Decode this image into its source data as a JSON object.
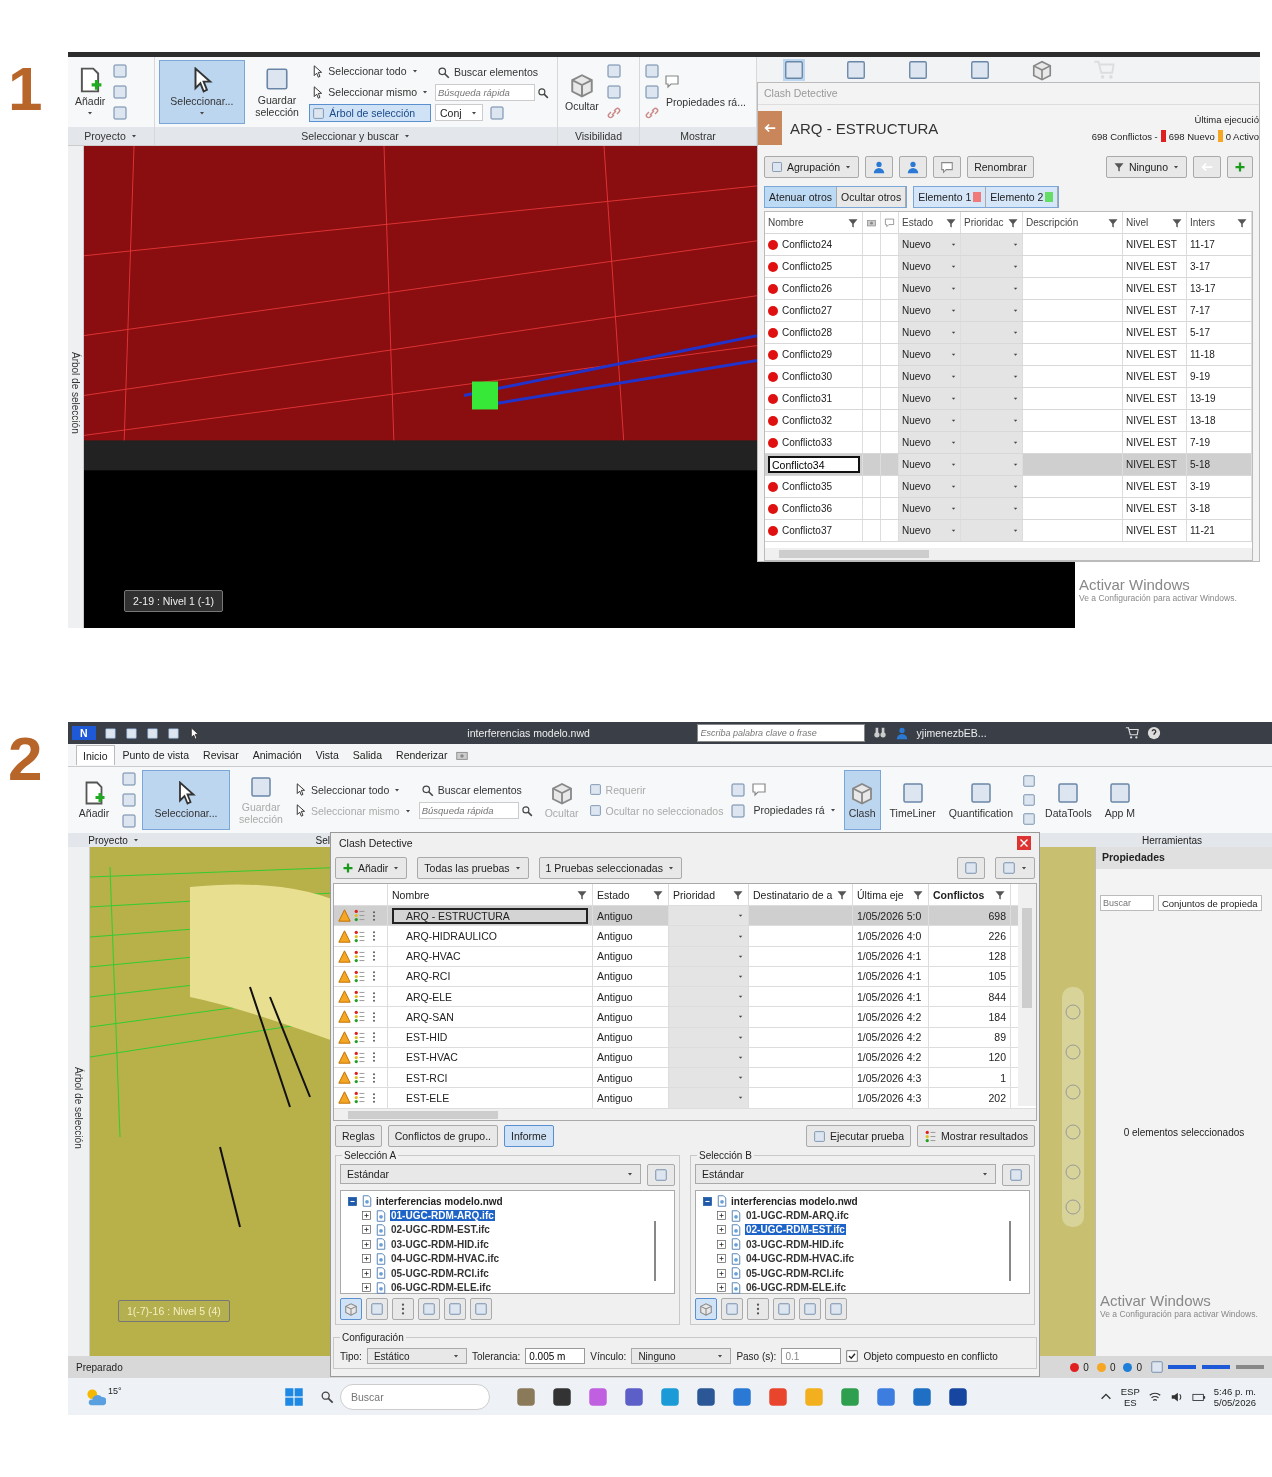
{
  "fig1": {
    "number": "1",
    "ribbon": {
      "add": "Añadir",
      "select": {
        "label": "Seleccionar...",
        "selected": true
      },
      "save": "Guardar selección",
      "select_all": "Seleccionar todo",
      "select_same": "Seleccionar mismo",
      "tree": {
        "label": "Árbol de selección",
        "selected": true
      },
      "find": "Buscar elementos",
      "quick_find": {
        "placeholder": "Búsqueda rápida"
      },
      "sets": "Conj",
      "hide": "Ocultar",
      "properties": "Propiedades rá...",
      "panels": [
        {
          "label": "Proyecto",
          "menu": true
        },
        {
          "label": "Seleccionar y buscar",
          "menu": true
        },
        {
          "label": "Visibilidad",
          "menu": false
        },
        {
          "label": "Mostrar",
          "menu": false
        }
      ]
    },
    "side_tab": "Árbol de selección",
    "viewport": {
      "label": "2-19 : Nivel 1 (-1)"
    },
    "clash": {
      "title": "Clash Detective",
      "test": "ARQ - ESTRUCTURA",
      "last_run": "Última ejecució",
      "total": "698 Conflictos -",
      "counts": [
        {
          "label": "698 Nuevo",
          "color": "#e02020"
        },
        {
          "label": "0 Activo",
          "color": "#f5a623"
        }
      ],
      "grouping": "Agrupación",
      "rename": "Renombrar",
      "assign": "Ninguno",
      "modes": [
        {
          "label": "Atenuar otros",
          "selected": true
        },
        {
          "label": "Ocultar otros",
          "selected": false
        }
      ],
      "items": [
        {
          "label": "Elemento 1",
          "color": "#f07a7a"
        },
        {
          "label": "Elemento 2",
          "color": "#66dd66"
        }
      ],
      "columns": [
        {
          "kind": "text",
          "label": "Nombre"
        },
        {
          "kind": "camera"
        },
        {
          "kind": "comment"
        },
        {
          "kind": "text",
          "label": "Estado"
        },
        {
          "kind": "text",
          "label": "Prioridac"
        },
        {
          "kind": "text",
          "label": "Descripción"
        },
        {
          "kind": "text",
          "label": "Nivel"
        },
        {
          "kind": "text",
          "label": "Inters"
        }
      ],
      "rows": [
        {
          "name": "Conflicto24",
          "status": "Nuevo",
          "tier": "NIVEL EST",
          "grid": "11-17",
          "selected": false
        },
        {
          "name": "Conflicto25",
          "status": "Nuevo",
          "tier": "NIVEL EST",
          "grid": "3-17",
          "selected": false
        },
        {
          "name": "Conflicto26",
          "status": "Nuevo",
          "tier": "NIVEL EST",
          "grid": "13-17",
          "selected": false
        },
        {
          "name": "Conflicto27",
          "status": "Nuevo",
          "tier": "NIVEL EST",
          "grid": "7-17",
          "selected": false
        },
        {
          "name": "Conflicto28",
          "status": "Nuevo",
          "tier": "NIVEL EST",
          "grid": "5-17",
          "selected": false
        },
        {
          "name": "Conflicto29",
          "status": "Nuevo",
          "tier": "NIVEL EST",
          "grid": "11-18",
          "selected": false
        },
        {
          "name": "Conflicto30",
          "status": "Nuevo",
          "tier": "NIVEL EST",
          "grid": "9-19",
          "selected": false
        },
        {
          "name": "Conflicto31",
          "status": "Nuevo",
          "tier": "NIVEL EST",
          "grid": "13-19",
          "selected": false
        },
        {
          "name": "Conflicto32",
          "status": "Nuevo",
          "tier": "NIVEL EST",
          "grid": "13-18",
          "selected": false
        },
        {
          "name": "Conflicto33",
          "status": "Nuevo",
          "tier": "NIVEL EST",
          "grid": "7-19",
          "selected": false
        },
        {
          "name": "Conflicto34",
          "status": "Nuevo",
          "tier": "NIVEL EST",
          "grid": "5-18",
          "selected": true
        },
        {
          "name": "Conflicto35",
          "status": "Nuevo",
          "tier": "NIVEL EST",
          "grid": "3-19",
          "selected": false
        },
        {
          "name": "Conflicto36",
          "status": "Nuevo",
          "tier": "NIVEL EST",
          "grid": "3-18",
          "selected": false
        },
        {
          "name": "Conflicto37",
          "status": "Nuevo",
          "tier": "NIVEL EST",
          "grid": "11-21",
          "selected": false
        }
      ]
    },
    "watermark": {
      "title": "Activar Windows",
      "text": "Ve a Configuración para activar Windows."
    }
  },
  "fig2": {
    "number": "2",
    "titlebar": {
      "logo": "N",
      "title": "interferencias modelo.nwd",
      "search": {
        "placeholder": "Escriba palabra clave o frase"
      },
      "user": "yjimenezbEB..."
    },
    "menu": [
      {
        "label": "Inicio",
        "selected": true
      },
      {
        "label": "Punto de vista",
        "selected": false
      },
      {
        "label": "Revisar",
        "selected": false
      },
      {
        "label": "Animación",
        "selected": false
      },
      {
        "label": "Vista",
        "selected": false
      },
      {
        "label": "Salida",
        "selected": false
      },
      {
        "label": "Renderizar",
        "selected": false
      }
    ],
    "ribbon": {
      "add": "Añadir",
      "select": {
        "label": "Seleccionar...",
        "selected": true
      },
      "save": {
        "label": "Guardar selección",
        "disabled": true
      },
      "select_all": {
        "label": "Seleccionar todo",
        "disabled": false
      },
      "select_same": {
        "label": "Seleccionar mismo",
        "disabled": true
      },
      "find": "Buscar elementos",
      "quick_find": {
        "placeholder": "Búsqueda rápida"
      },
      "hide": {
        "label": "Ocultar",
        "disabled": true
      },
      "require": {
        "label": "Requerir",
        "disabled": true
      },
      "hide_unselected": {
        "label": "Ocultar no seleccionados",
        "disabled": true
      },
      "properties": "Propiedades rá",
      "tools": [
        {
          "label": "Clash",
          "selected": true
        },
        {
          "label": "TimeLiner",
          "selected": false
        },
        {
          "label": "Quantification",
          "selected": false
        },
        {
          "label": "DataTools",
          "selected": false
        },
        {
          "label": "App M",
          "selected": false
        }
      ],
      "panels": [
        {
          "label": "Proyecto",
          "menu": true
        },
        {
          "label": "Sel",
          "menu": false
        },
        {
          "label": "Herramientas",
          "menu": false
        }
      ]
    },
    "side_tab": "Árbol de selección",
    "viewport": {
      "label": "1(-7)-16 : Nivel 5 (4)"
    },
    "properties": {
      "title": "Propiedades",
      "search": {
        "placeholder": "Buscar"
      },
      "tab": "Conjuntos de propieda",
      "empty": "0 elementos seleccionados"
    },
    "clash": {
      "title": "Clash Detective",
      "buttons": [
        "Añadir",
        "Todas las pruebas",
        "1 Pruebas seleccionadas"
      ],
      "columns": [
        "Nombre",
        "Estado",
        "Prioridad",
        "Destinatario de a",
        "Última eje",
        "Conflictos"
      ],
      "rows": [
        {
          "name": "ARQ - ESTRUCTURA",
          "status": "Antiguo",
          "last_run": "1/05/2026 5:0",
          "count": "698",
          "selected": true
        },
        {
          "name": "ARQ-HIDRAULICO",
          "status": "Antiguo",
          "last_run": "1/05/2026 4:0",
          "count": "226",
          "selected": false
        },
        {
          "name": "ARQ-HVAC",
          "status": "Antiguo",
          "last_run": "1/05/2026 4:1",
          "count": "128",
          "selected": false
        },
        {
          "name": "ARQ-RCI",
          "status": "Antiguo",
          "last_run": "1/05/2026 4:1",
          "count": "105",
          "selected": false
        },
        {
          "name": "ARQ-ELE",
          "status": "Antiguo",
          "last_run": "1/05/2026 4:1",
          "count": "844",
          "selected": false
        },
        {
          "name": "ARQ-SAN",
          "status": "Antiguo",
          "last_run": "1/05/2026 4:2",
          "count": "184",
          "selected": false
        },
        {
          "name": "EST-HID",
          "status": "Antiguo",
          "last_run": "1/05/2026 4:2",
          "count": "89",
          "selected": false
        },
        {
          "name": "EST-HVAC",
          "status": "Antiguo",
          "last_run": "1/05/2026 4:2",
          "count": "120",
          "selected": false
        },
        {
          "name": "EST-RCI",
          "status": "Antiguo",
          "last_run": "1/05/2026 4:3",
          "count": "1",
          "selected": false
        },
        {
          "name": "EST-ELE",
          "status": "Antiguo",
          "last_run": "1/05/2026 4:3",
          "count": "202",
          "selected": false
        }
      ],
      "tabs": [
        {
          "label": "Reglas",
          "selected": false
        },
        {
          "label": "Conflictos de grupo..",
          "selected": false
        },
        {
          "label": "Informe",
          "selected": true
        }
      ],
      "actions": [
        "Ejecutar prueba",
        "Mostrar resultados"
      ],
      "selections": [
        {
          "title": "Selección A",
          "mode": "Estándar",
          "root": "interferencias modelo.nwd",
          "files": [
            {
              "name": "01-UGC-RDM-ARQ.ifc",
              "selected": true
            },
            {
              "name": "02-UGC-RDM-EST.ifc",
              "selected": false
            },
            {
              "name": "03-UGC-RDM-HID.ifc",
              "selected": false
            },
            {
              "name": "04-UGC-RDM-HVAC.ifc",
              "selected": false
            },
            {
              "name": "05-UGC-RDM-RCI.ifc",
              "selected": false
            },
            {
              "name": "06-UGC-RDM-ELE.ifc",
              "selected": false
            }
          ]
        },
        {
          "title": "Selección B",
          "mode": "Estándar",
          "root": "interferencias modelo.nwd",
          "files": [
            {
              "name": "01-UGC-RDM-ARQ.ifc",
              "selected": false
            },
            {
              "name": "02-UGC-RDM-EST.ifc",
              "selected": true
            },
            {
              "name": "03-UGC-RDM-HID.ifc",
              "selected": false
            },
            {
              "name": "04-UGC-RDM-HVAC.ifc",
              "selected": false
            },
            {
              "name": "05-UGC-RDM-RCI.ifc",
              "selected": false
            },
            {
              "name": "06-UGC-RDM-ELE.ifc",
              "selected": false
            }
          ]
        }
      ],
      "config": {
        "title": "Configuración",
        "type_label": "Tipo:",
        "type": "Estático",
        "tolerance_label": "Tolerancia:",
        "tolerance": "0.005 m",
        "link_label": "Vínculo:",
        "link": "Ninguno",
        "step_label": "Paso (s):",
        "step": "0.1",
        "composite": {
          "label": "Objeto compuesto en conflicto",
          "checked": true
        }
      }
    },
    "status": {
      "text": "Preparado",
      "indicators": [
        {
          "value": "0",
          "color": "#e02020"
        },
        {
          "value": "0",
          "color": "#f5a623"
        },
        {
          "value": "0",
          "color": "#1e7fd8"
        }
      ]
    },
    "taskbar": {
      "weather": "15°",
      "search": {
        "placeholder": "Buscar"
      },
      "lang": "ESP",
      "layout": "ES",
      "time": "5:46 p. m.",
      "date": "5/05/2026",
      "apps": [
        {
          "color": "#8a7a5a"
        },
        {
          "color": "#333333"
        },
        {
          "color": "#c060e0"
        },
        {
          "color": "#5b5fc7"
        },
        {
          "color": "#1a9ad6"
        },
        {
          "color": "#2b5797"
        },
        {
          "color": "#2a7ad5"
        },
        {
          "color": "#e8452c"
        },
        {
          "color": "#f2b01e"
        },
        {
          "color": "#2e9e4f"
        },
        {
          "color": "#3d7de0"
        },
        {
          "color": "#1f6fc5"
        },
        {
          "color": "#1746a0"
        }
      ]
    },
    "watermark": {
      "title": "Activar Windows",
      "text": "Ve a Configuración para activar Windows."
    }
  }
}
